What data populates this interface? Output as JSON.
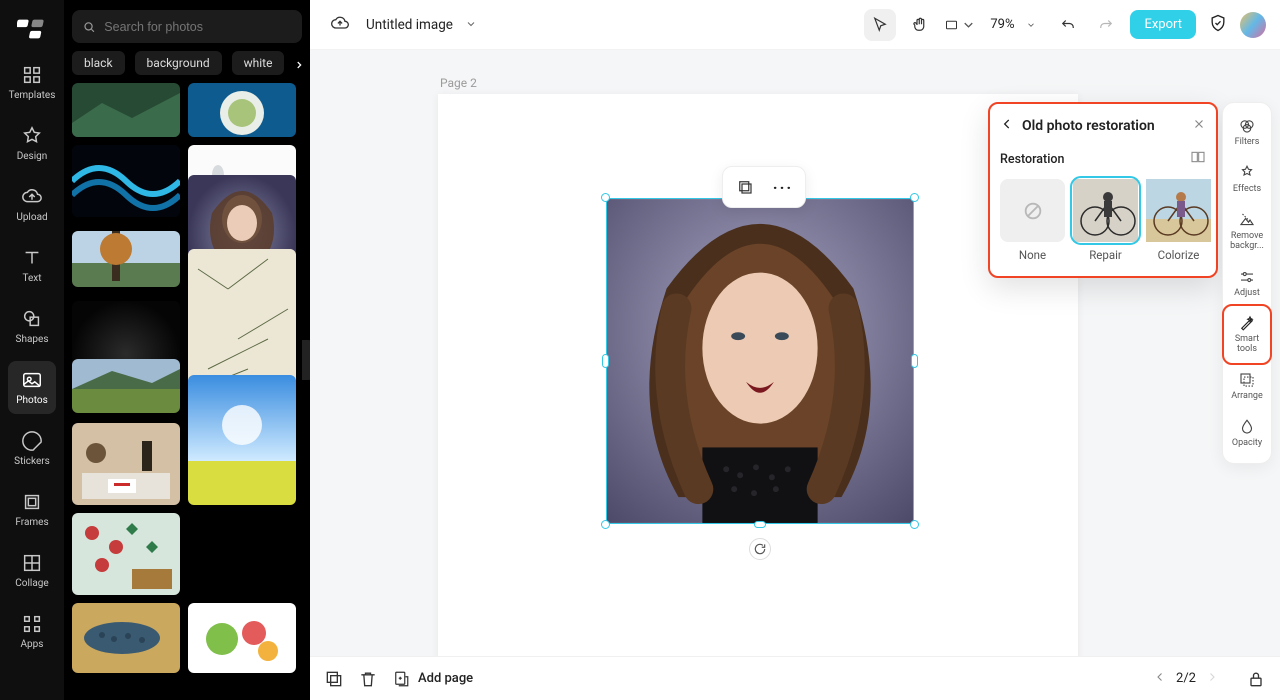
{
  "leftnav": {
    "items": [
      {
        "label": "Templates"
      },
      {
        "label": "Design"
      },
      {
        "label": "Upload"
      },
      {
        "label": "Text"
      },
      {
        "label": "Shapes"
      },
      {
        "label": "Photos"
      },
      {
        "label": "Stickers"
      },
      {
        "label": "Frames"
      },
      {
        "label": "Collage"
      },
      {
        "label": "Apps"
      }
    ]
  },
  "search": {
    "placeholder": "Search for photos"
  },
  "tags": [
    "black",
    "background",
    "white"
  ],
  "topbar": {
    "doc_title": "Untitled image",
    "zoom": "79%",
    "export_label": "Export"
  },
  "canvas": {
    "page_label": "Page 2"
  },
  "popover": {
    "title": "Old photo restoration",
    "section_label": "Restoration",
    "options": [
      {
        "label": "None"
      },
      {
        "label": "Repair"
      },
      {
        "label": "Colorize"
      }
    ],
    "selected_index": 1
  },
  "toolrail": {
    "items": [
      {
        "label": "Filters"
      },
      {
        "label": "Effects"
      },
      {
        "label": "Remove backgr..."
      },
      {
        "label": "Adjust"
      },
      {
        "label": "Smart tools"
      },
      {
        "label": "Arrange"
      },
      {
        "label": "Opacity"
      }
    ],
    "highlight_index": 4
  },
  "bottombar": {
    "add_page_label": "Add page",
    "page_indicator": "2/2"
  },
  "colors": {
    "accent": "#33c8e5",
    "highlight": "#f14424",
    "export_btn": "#31d0e9"
  }
}
